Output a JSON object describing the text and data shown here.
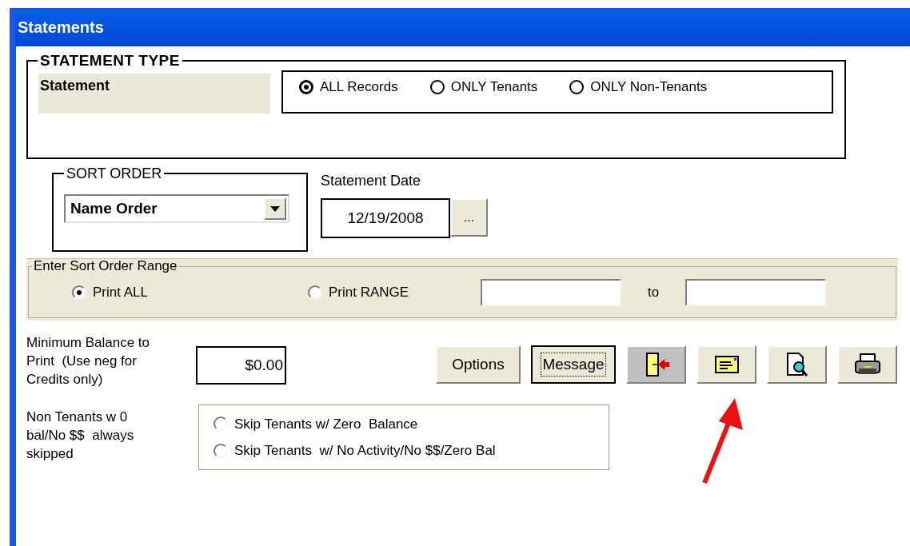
{
  "window": {
    "title": "Statements"
  },
  "statement_type": {
    "legend": "STATEMENT TYPE",
    "label": "Statement",
    "options": [
      {
        "label": "ALL Records",
        "selected": true
      },
      {
        "label": "ONLY Tenants",
        "selected": false
      },
      {
        "label": "ONLY Non-Tenants",
        "selected": false
      }
    ]
  },
  "sort_order": {
    "legend": "SORT ORDER",
    "value": "Name Order"
  },
  "statement_date": {
    "label": "Statement Date",
    "value": "12/19/2008",
    "picker_button": "..."
  },
  "sort_range": {
    "legend": "Enter Sort Order Range",
    "options": [
      {
        "label": "Print ALL",
        "selected": true
      },
      {
        "label": "Print RANGE",
        "selected": false
      }
    ],
    "separator": "to"
  },
  "minimum_balance": {
    "label": "Minimum Balance to Print  (Use neg for Credits only)",
    "value": "$0.00"
  },
  "buttons": [
    {
      "kind": "text",
      "label": "Options",
      "focused": false,
      "active": false
    },
    {
      "kind": "text",
      "label": "Message",
      "focused": true,
      "active": false
    },
    {
      "kind": "icon",
      "focused": false,
      "active": true
    },
    {
      "kind": "icon",
      "focused": false,
      "active": false
    },
    {
      "kind": "icon",
      "focused": false,
      "active": false
    },
    {
      "kind": "icon",
      "focused": false,
      "active": false
    }
  ],
  "skip_note": "Non Tenants w 0 bal/No $$  always skipped",
  "skip_options": [
    {
      "label": "Skip Tenants w/ Zero  Balance",
      "selected": false
    },
    {
      "label": "Skip Tenants  w/ No Activity/No $$/Zero Bal",
      "selected": false
    }
  ]
}
